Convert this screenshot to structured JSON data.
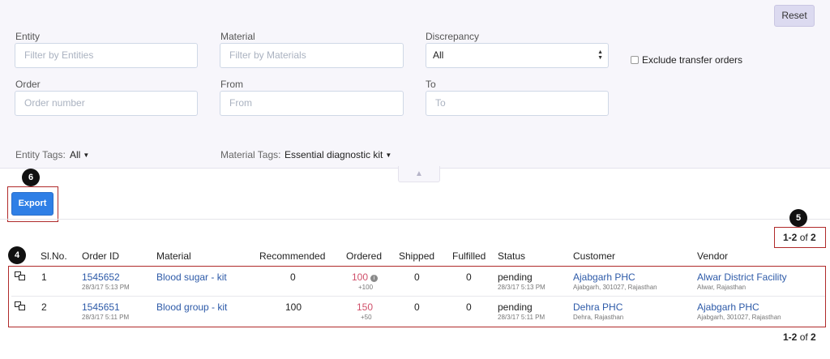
{
  "filters": {
    "reset_label": "Reset",
    "entity": {
      "label": "Entity",
      "placeholder": "Filter by Entities"
    },
    "material": {
      "label": "Material",
      "placeholder": "Filter by Materials"
    },
    "discrepancy": {
      "label": "Discrepancy",
      "value": "All"
    },
    "exclude_transfer_label": "Exclude transfer orders",
    "order": {
      "label": "Order",
      "placeholder": "Order number"
    },
    "from": {
      "label": "From",
      "placeholder": "From"
    },
    "to": {
      "label": "To",
      "placeholder": "To"
    },
    "entity_tags": {
      "label": "Entity Tags:",
      "value": "All"
    },
    "material_tags": {
      "label": "Material Tags:",
      "value": "Essential diagnostic kit"
    }
  },
  "markers": {
    "export": "6",
    "pager": "5",
    "rows": "4"
  },
  "export_label": "Export",
  "pagination": {
    "range": "1-2",
    "of_word": "of",
    "total": "2"
  },
  "table": {
    "headers": [
      "Sl.No.",
      "Order ID",
      "Material",
      "Recommended",
      "Ordered",
      "Shipped",
      "Fulfilled",
      "Status",
      "Customer",
      "Vendor"
    ],
    "rows": [
      {
        "sl": "1",
        "order_id": "1545652",
        "order_time": "28/3/17 5:13 PM",
        "material": "Blood sugar - kit",
        "recommended": "0",
        "ordered": "100",
        "ordered_diff": "+100",
        "shipped": "0",
        "fulfilled": "0",
        "status": "pending",
        "status_time": "28/3/17 5:13 PM",
        "customer": "Ajabgarh PHC",
        "customer_addr": "Ajabgarh, 301027, Rajasthan",
        "vendor": "Alwar District Facility",
        "vendor_addr": "Alwar, Rajasthan"
      },
      {
        "sl": "2",
        "order_id": "1545651",
        "order_time": "28/3/17 5:11 PM",
        "material": "Blood group - kit",
        "recommended": "100",
        "ordered": "150",
        "ordered_diff": "+50",
        "shipped": "0",
        "fulfilled": "0",
        "status": "pending",
        "status_time": "28/3/17 5:11 PM",
        "customer": "Dehra PHC",
        "customer_addr": "Dehra, Rajasthan",
        "vendor": "Ajabgarh PHC",
        "vendor_addr": "Ajabgarh, 301027, Rajasthan"
      }
    ]
  }
}
